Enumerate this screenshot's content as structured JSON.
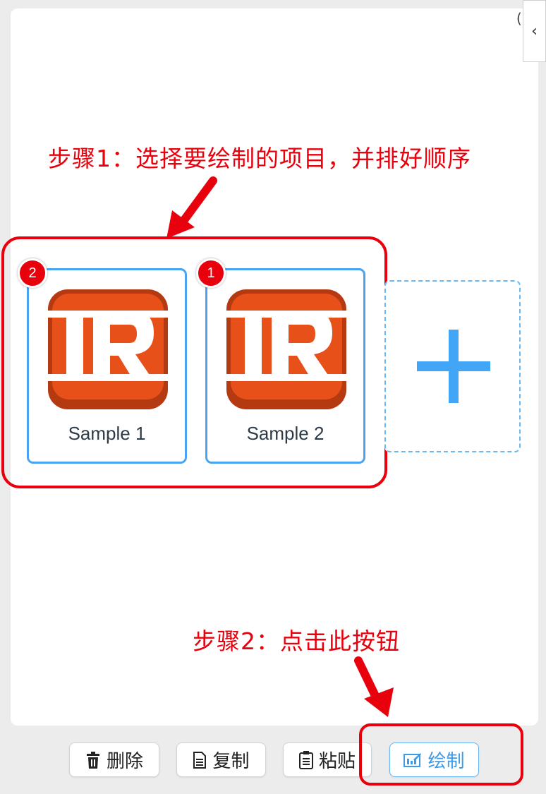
{
  "collapse_tab": {
    "icon": "chevron-left-icon",
    "glyph": "‹"
  },
  "corner_glyph": "(",
  "annotations": {
    "step1": "步骤1：选择要绘制的项目，并排好顺序",
    "step2": "步骤2：点击此按钮"
  },
  "cards": [
    {
      "label": "Sample 1",
      "order_badge": "2",
      "icon": "ir-logo-icon"
    },
    {
      "label": "Sample 2",
      "order_badge": "1",
      "icon": "ir-logo-icon"
    }
  ],
  "add_card": {
    "icon": "plus-icon"
  },
  "toolbar": {
    "delete": {
      "label": "删除",
      "icon": "trash-icon"
    },
    "copy": {
      "label": "复制",
      "icon": "document-icon"
    },
    "paste": {
      "label": "粘贴",
      "icon": "clipboard-icon"
    },
    "draw": {
      "label": "绘制",
      "icon": "draw-icon"
    }
  },
  "colors": {
    "annotation_red": "#e8000d",
    "card_border": "#4aa3ee",
    "accent_blue": "#42a5f5",
    "logo_orange": "#e8501a",
    "logo_dark": "#b53a12"
  }
}
